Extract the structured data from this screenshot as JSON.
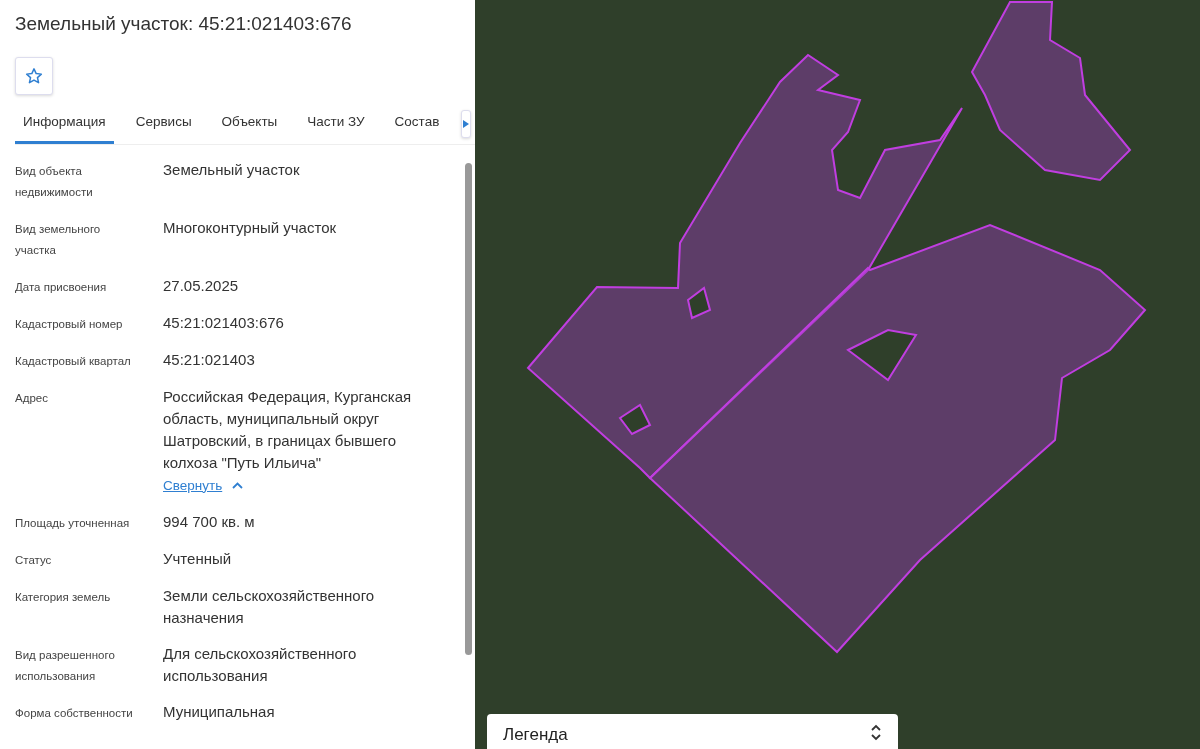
{
  "panel": {
    "title": "Земельный участок: 45:21:021403:676",
    "tabs": [
      {
        "label": "Информация",
        "selected": true
      },
      {
        "label": "Сервисы",
        "selected": false
      },
      {
        "label": "Объекты",
        "selected": false
      },
      {
        "label": "Части ЗУ",
        "selected": false
      },
      {
        "label": "Состав",
        "selected": false
      }
    ],
    "properties": [
      {
        "label": "Вид объекта недвижимости",
        "value": "Земельный участок"
      },
      {
        "label": "Вид земельного участка",
        "value": "Многоконтурный участок"
      },
      {
        "label": "Дата присвоения",
        "value": "27.05.2025"
      },
      {
        "label": "Кадастровый номер",
        "value": "45:21:021403:676"
      },
      {
        "label": "Кадастровый квартал",
        "value": "45:21:021403"
      },
      {
        "label": "Адрес",
        "value": "Российская Федерация, Курганская область, муниципальный округ Шатровский, в границах бывшего колхоза \"Путь Ильича\"",
        "link": "Свернуть"
      },
      {
        "label": "Площадь уточненная",
        "value": "994 700 кв. м"
      },
      {
        "label": "Статус",
        "value": "Учтенный"
      },
      {
        "label": "Категория земель",
        "value": "Земли сельскохозяйственного назначения"
      },
      {
        "label": "Вид разрешенного использования",
        "value": "Для сельскохозяйственного использования"
      },
      {
        "label": "Форма собственности",
        "value": "Муниципальная"
      }
    ]
  },
  "map": {
    "legend": {
      "title": "Легенда"
    }
  }
}
